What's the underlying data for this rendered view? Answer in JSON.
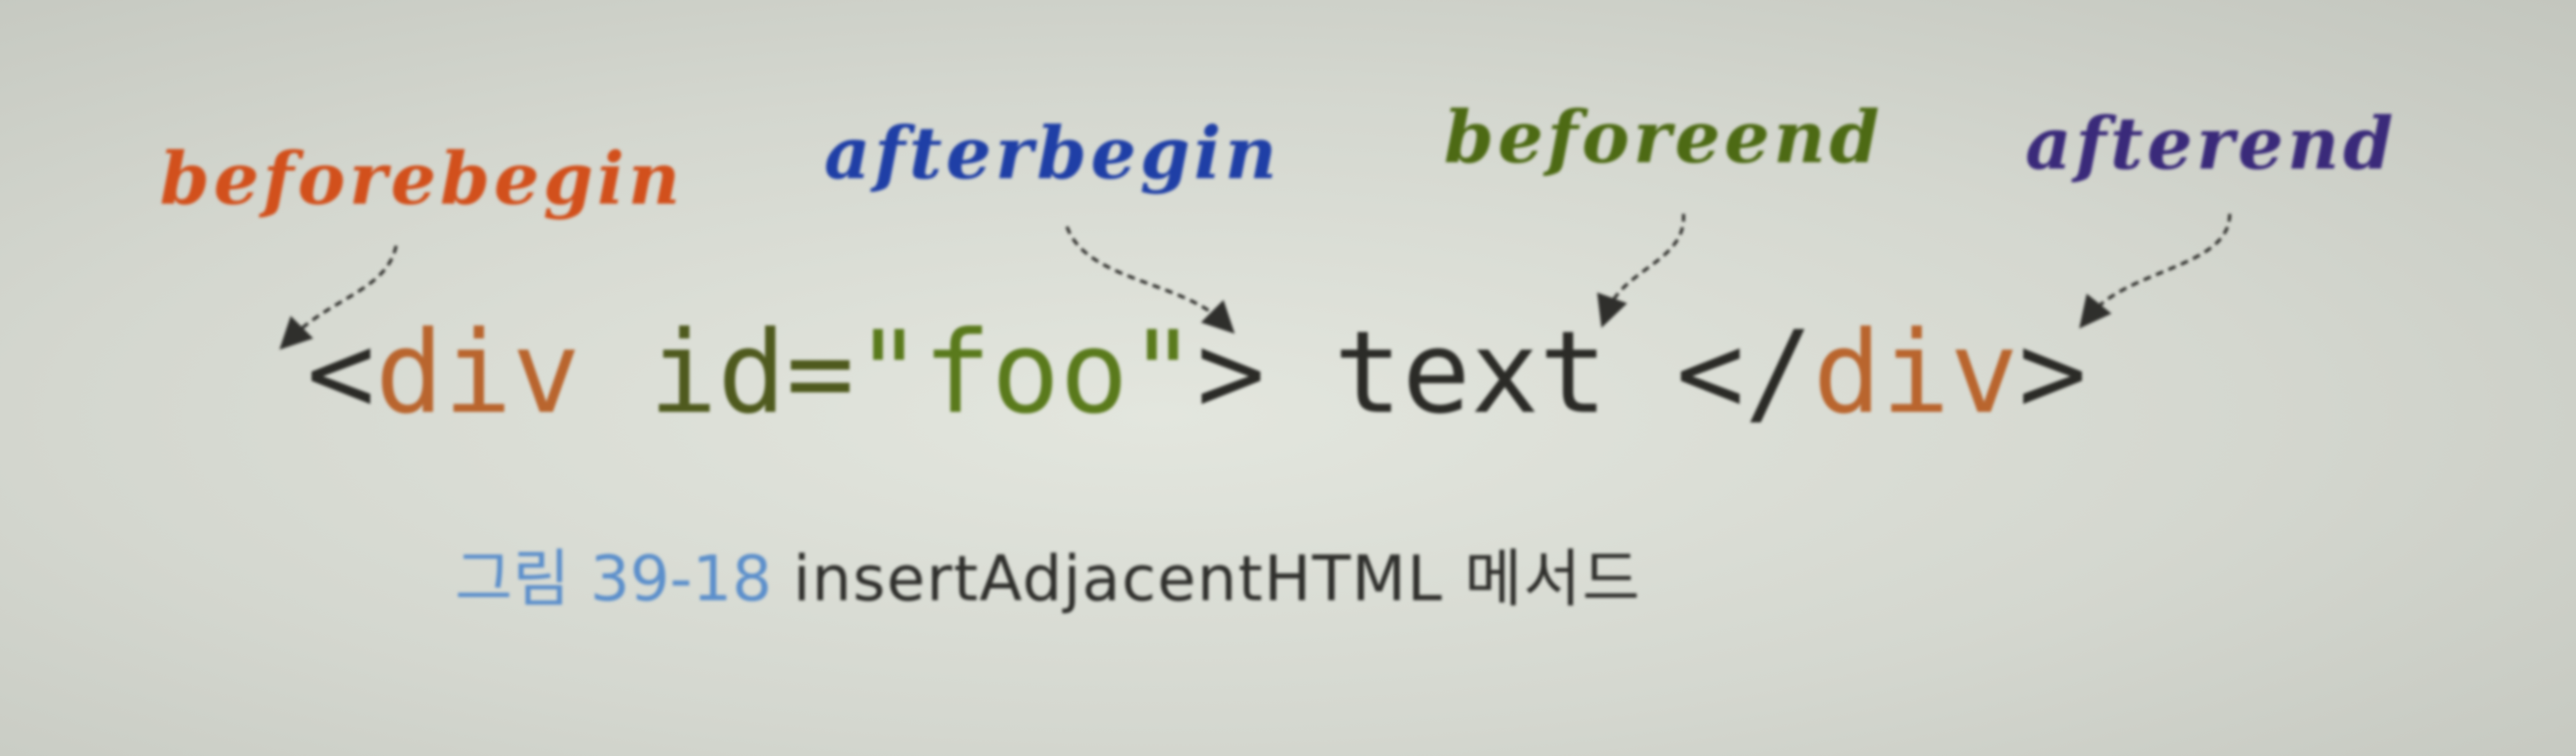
{
  "labels": {
    "beforebegin": "beforebegin",
    "afterbegin": "afterbegin",
    "beforeend": "beforeend",
    "afterend": "afterend"
  },
  "code": {
    "open_lt": "<",
    "open_tag": "div",
    "attr_name": " id=",
    "attr_value": "\"foo\"",
    "open_gt": ">",
    "content": " text ",
    "close_lt": "</",
    "close_tag": "div",
    "close_gt": ">"
  },
  "caption": {
    "number": "그림 39-18",
    "title": " insertAdjacentHTML 메서드"
  },
  "colors": {
    "beforebegin": "#d2501c",
    "afterbegin": "#1f3fa6",
    "beforeend": "#4d6a14",
    "afterend": "#3a2a7a",
    "tag": "#b9652e",
    "attr_value": "#5a7a1c",
    "text": "#2b2b27",
    "caption_number": "#5c8fcb"
  }
}
